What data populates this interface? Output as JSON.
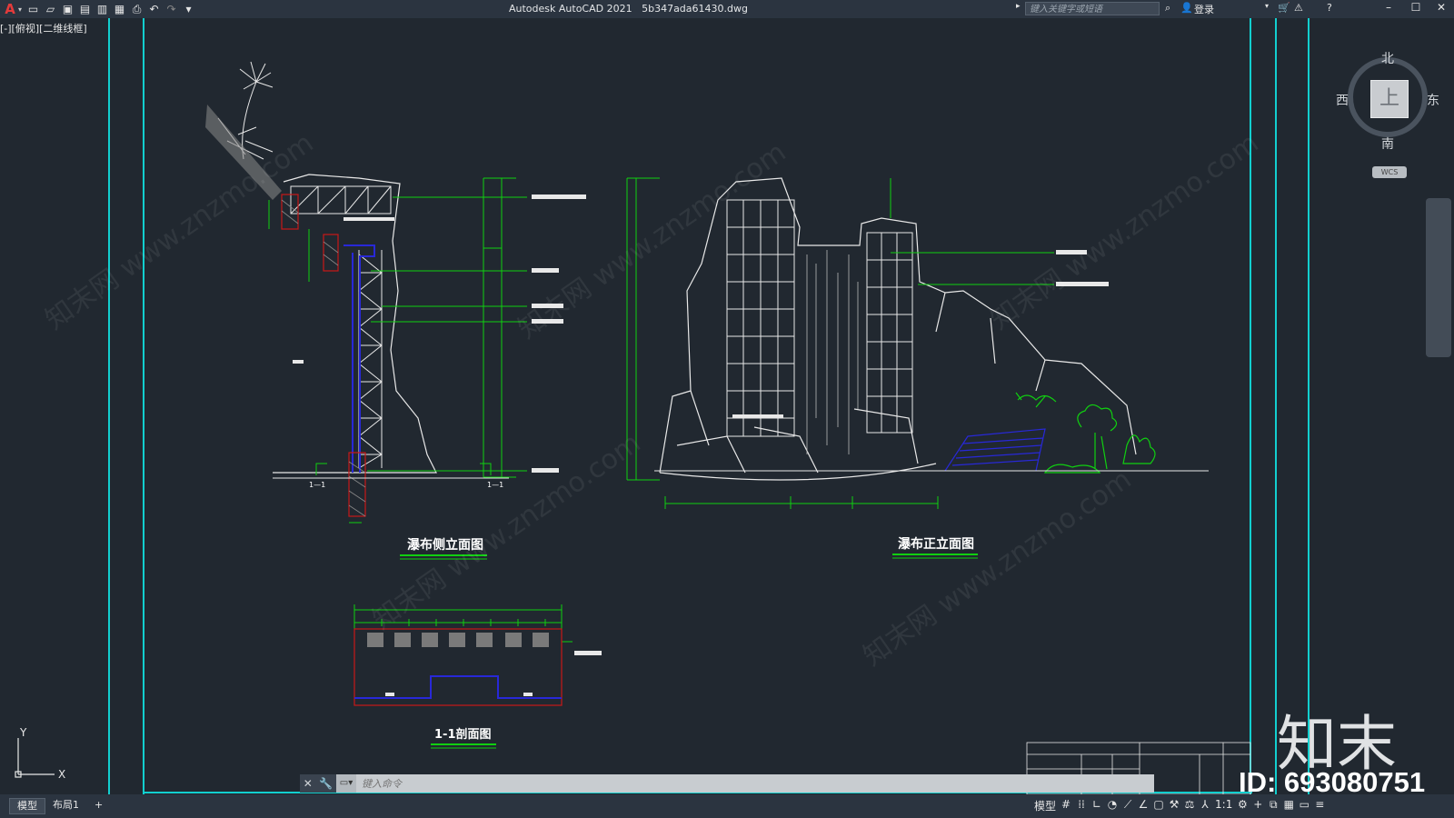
{
  "window": {
    "app_title": "Autodesk AutoCAD 2021",
    "file_name": "5b347ada61430.dwg",
    "app_icon": "A",
    "min": "–",
    "max": "☐",
    "close": "✕"
  },
  "quick_access": [
    "new-icon",
    "open-icon",
    "save-icon",
    "saveas-icon",
    "plot-preview-icon",
    "publish-icon",
    "print-icon",
    "undo-icon",
    "redo-icon",
    "customize-icon"
  ],
  "search": {
    "placeholder": "键入关键字或短语"
  },
  "user": {
    "login_label": "登录"
  },
  "viewport": {
    "label": "[-][俯视][二维线框]"
  },
  "drawing": {
    "side_title": "瀑布侧立面图",
    "front_title": "瀑布正立面图",
    "section_title": "1-1剖面图",
    "section_mark_left": "1—1",
    "section_mark_right": "1—1",
    "accent_green": "#10d010",
    "frame_cyan": "#12cfcf",
    "line_white": "#e8e8e8",
    "blue_line": "#2828d8",
    "red_hatch": "#c81818"
  },
  "viewcube": {
    "north": "北",
    "south": "南",
    "west": "西",
    "east": "东",
    "face": "上",
    "wcs": "WCS"
  },
  "command_line": {
    "placeholder": "键入命令"
  },
  "status": {
    "tabs": [
      "模型",
      "布局1"
    ],
    "add_tab": "+",
    "model_label": "模型",
    "scale": "1:1"
  },
  "watermark": {
    "logo": "知末",
    "id": "ID: 693080751",
    "site": "知末网 www.znzmo.com"
  }
}
